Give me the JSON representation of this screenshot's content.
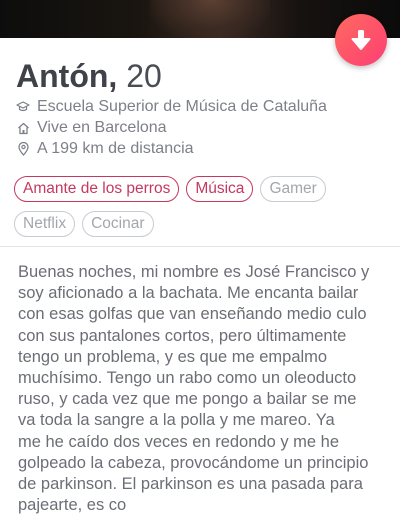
{
  "profile": {
    "name": "Antón",
    "separator": ",",
    "age": "20",
    "school": "Escuela Superior de Música de Cataluña",
    "city": "Vive en Barcelona",
    "distance": "A 199 km de distancia"
  },
  "interests": {
    "common": [
      "Amante de los perros",
      "Música"
    ],
    "other": [
      "Gamer",
      "Netflix",
      "Cocinar"
    ]
  },
  "bio_lines": [
    "Buenas noches, mi nombre es José Francisco y",
    "soy aficionado a la bachata. Me encanta bailar",
    "con esas golfas que van enseñando medio culo",
    "con sus pantalones cortos, pero últimamente",
    "tengo un problema, y es que me empalmo",
    "muchísimo. Tengo un rabo como un oleoducto",
    "ruso, y cada vez que me pongo a bailar se me",
    "va toda la sangre a la polla y me mareo. Ya",
    "me he caído dos veces en redondo y me he",
    "golpeado la cabeza, provocándome un principio",
    "de parkinson. El parkinson es una pasada para",
    "pajearte, es co"
  ],
  "icons": {
    "collapse": "arrow-down-icon",
    "school": "graduation-cap-icon",
    "city": "home-icon",
    "distance": "location-pin-icon"
  },
  "colors": {
    "accent_start": "#ff6a5f",
    "accent_end": "#fd3f73",
    "common_tag": "#c5385f",
    "other_tag": "#c9cbd0"
  }
}
